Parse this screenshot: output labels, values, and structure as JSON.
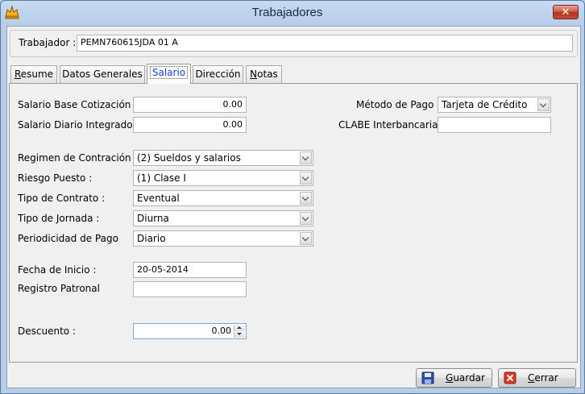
{
  "window": {
    "title": "Trabajadores",
    "close_label": "✕"
  },
  "trabajador": {
    "label": "Trabajador :",
    "value": "PEMN760615JDA 01 A"
  },
  "tabs": [
    {
      "label": "Resume",
      "mnemonic_index": 0,
      "active": false
    },
    {
      "label": "Datos Generales",
      "active": false
    },
    {
      "label": "Salario",
      "active": true
    },
    {
      "label": "Dirección",
      "active": false
    },
    {
      "label": "Notas",
      "mnemonic_index": 0,
      "active": false
    }
  ],
  "salario": {
    "base_cotizacion": {
      "label": "Salario Base Cotización :",
      "value": "0.00"
    },
    "diario_integrado": {
      "label": "Salario Diario Integrado",
      "value": "0.00"
    },
    "metodo_pago": {
      "label": "Método de Pago :",
      "value": "Tarjeta de Crédito"
    },
    "clabe": {
      "label": "CLABE Interbancaria :",
      "value": ""
    },
    "regimen": {
      "label": "Regimen de Contración :",
      "value": "(2) Sueldos y salarios"
    },
    "riesgo": {
      "label": "Riesgo Puesto :",
      "value": "(1) Clase I"
    },
    "tipo_contrato": {
      "label": "Tipo de Contrato :",
      "value": "Eventual"
    },
    "tipo_jornada": {
      "label": "Tipo de Jornada :",
      "value": "Diurna"
    },
    "periodicidad": {
      "label": "Periodicidad de Pago",
      "value": "Diario"
    },
    "fecha_inicio": {
      "label": "Fecha de Inicio :",
      "value": "20-05-2014"
    },
    "registro_patronal": {
      "label": "Registro Patronal",
      "value": ""
    },
    "descuento": {
      "label": "Descuento :",
      "value": "0.00"
    }
  },
  "buttons": {
    "guardar": {
      "label": "Guardar"
    },
    "cerrar": {
      "label": "Cerrar"
    }
  },
  "icons": {
    "app": "app-icon",
    "save": "save-icon",
    "close": "close-icon"
  },
  "colors": {
    "accent": "#1c3cc8",
    "close_red": "#c64b36"
  }
}
